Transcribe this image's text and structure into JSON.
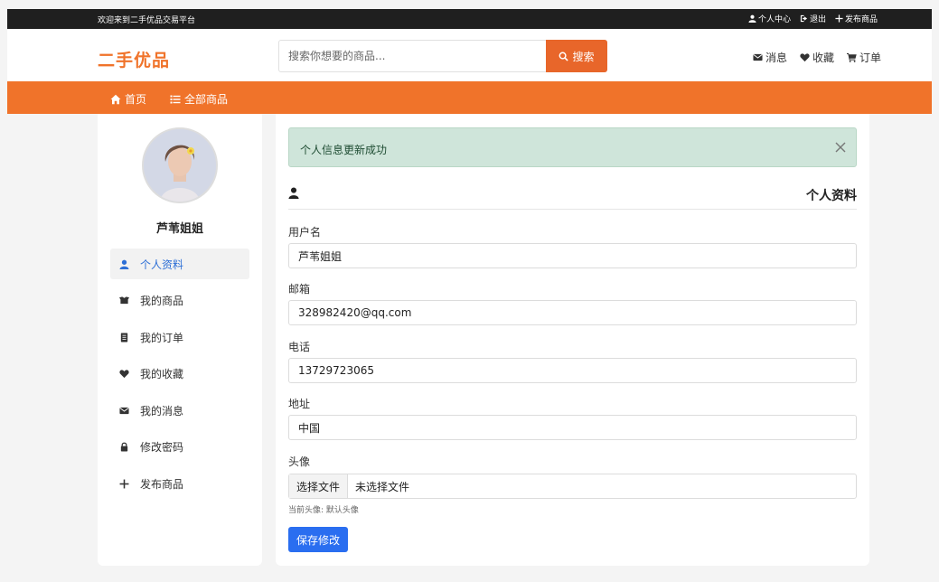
{
  "topbar": {
    "welcome": "欢迎来到二手优品交易平台",
    "personal_center": "个人中心",
    "logout": "退出",
    "publish": "发布商品"
  },
  "header": {
    "logo": "二手优品",
    "search_placeholder": "搜索你想要的商品...",
    "search_button": "搜索",
    "messages": "消息",
    "favorites": "收藏",
    "orders": "订单"
  },
  "nav": {
    "home": "首页",
    "all_products": "全部商品"
  },
  "sidebar": {
    "username": "芦苇姐姐",
    "items": [
      {
        "label": "个人资料",
        "icon": "user-icon"
      },
      {
        "label": "我的商品",
        "icon": "box-icon"
      },
      {
        "label": "我的订单",
        "icon": "receipt-icon"
      },
      {
        "label": "我的收藏",
        "icon": "heart-icon"
      },
      {
        "label": "我的消息",
        "icon": "envelope-icon"
      },
      {
        "label": "修改密码",
        "icon": "lock-icon"
      },
      {
        "label": "发布商品",
        "icon": "plus-icon"
      }
    ]
  },
  "main": {
    "alert": "个人信息更新成功",
    "title": "个人资料",
    "fields": {
      "username_label": "用户名",
      "username_value": "芦苇姐姐",
      "email_label": "邮箱",
      "email_value": "328982420@qq.com",
      "phone_label": "电话",
      "phone_value": "13729723065",
      "address_label": "地址",
      "address_value": "中国",
      "avatar_label": "头像"
    },
    "file_button": "选择文件",
    "file_status": "未选择文件",
    "avatar_hint": "当前头像: 默认头像",
    "save_button": "保存修改"
  },
  "colors": {
    "brand_orange": "#f0732a",
    "primary_blue": "#2a6ef0",
    "alert_green": "#cfe5da"
  }
}
